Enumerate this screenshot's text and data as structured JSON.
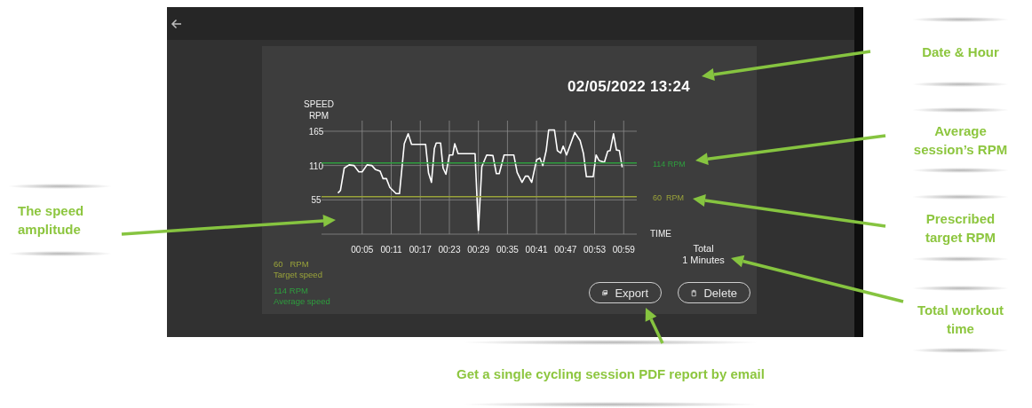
{
  "session": {
    "datetime": "02/05/2022 13:24",
    "total_label": "Total",
    "total_value": "1 Minutes"
  },
  "chart_data": {
    "type": "line",
    "ylabel": "SPEED RPM",
    "xlabel": "TIME",
    "xlim": [
      -3.4,
      61.7
    ],
    "ylim": [
      0,
      182
    ],
    "grid": true,
    "yticks": [
      55,
      110,
      165
    ],
    "xticks": [
      {
        "value": 5,
        "label": "00:05"
      },
      {
        "value": 11,
        "label": "00:11"
      },
      {
        "value": 17,
        "label": "00:17"
      },
      {
        "value": 23,
        "label": "00:23"
      },
      {
        "value": 29,
        "label": "00:29"
      },
      {
        "value": 35,
        "label": "00:35"
      },
      {
        "value": 41,
        "label": "00:41"
      },
      {
        "value": 47,
        "label": "00:47"
      },
      {
        "value": 53,
        "label": "00:53"
      },
      {
        "value": 59,
        "label": "00:59"
      }
    ],
    "x": [
      -3.4,
      0,
      0.5,
      1.3,
      2.3,
      3.3,
      4.3,
      5,
      6,
      7,
      7.7,
      8.7,
      9.3,
      10,
      10.7,
      12,
      12.7,
      13.7,
      14.5,
      15.2,
      18.1,
      18.7,
      19.3,
      19.9,
      20.3,
      21.2,
      21.7,
      22.3,
      23,
      23.7,
      24.1,
      24.8,
      28.3,
      29,
      29.7,
      30.7,
      32,
      32.7,
      33.3,
      34.3,
      36.3,
      37,
      38,
      38.7,
      39.3,
      40,
      41,
      41.7,
      42.3,
      43,
      43.5,
      44.7,
      45.3,
      46,
      46.5,
      47.2,
      48.9,
      50,
      50.7,
      51.3,
      52.7,
      53.3,
      53.9,
      55,
      55.7,
      56.2,
      56.9,
      57.5,
      58.1,
      58.7,
      61.7
    ],
    "series": [
      {
        "color": "#ffffff",
        "values": [
          null,
          66,
          70,
          106,
          111,
          110,
          100,
          100,
          111,
          110,
          104,
          101,
          89,
          89,
          75,
          65,
          65,
          145,
          161,
          144,
          144,
          98,
          83,
          137,
          146,
          146,
          106,
          96,
          127,
          127,
          145,
          129,
          129,
          6,
          108,
          127,
          126,
          97,
          97,
          127,
          127,
          99,
          83,
          93,
          93,
          83,
          119,
          122,
          110,
          134,
          167,
          167,
          134,
          130,
          141,
          127,
          163,
          150,
          129,
          92,
          92,
          127,
          118,
          115,
          133,
          134,
          161,
          135,
          134,
          107,
          null
        ]
      },
      {
        "name": "114 RPM",
        "color": "#2e9e3e",
        "values": [
          114,
          114,
          114,
          114,
          114,
          114,
          114,
          114,
          114,
          114,
          114,
          114,
          114,
          114,
          114,
          114,
          114,
          114,
          114,
          114,
          114,
          114,
          114,
          114,
          114,
          114,
          114,
          114,
          114,
          114,
          114,
          114,
          114,
          114,
          114,
          114,
          114,
          114,
          114,
          114,
          114,
          114,
          114,
          114,
          114,
          114,
          114,
          114,
          114,
          114,
          114,
          114,
          114,
          114,
          114,
          114,
          114,
          114,
          114,
          114,
          114,
          114,
          114,
          114,
          114,
          114,
          114,
          114,
          114,
          114,
          114
        ]
      },
      {
        "name": "60  RPM",
        "color": "#9aa33a",
        "values": [
          60,
          60,
          60,
          60,
          60,
          60,
          60,
          60,
          60,
          60,
          60,
          60,
          60,
          60,
          60,
          60,
          60,
          60,
          60,
          60,
          60,
          60,
          60,
          60,
          60,
          60,
          60,
          60,
          60,
          60,
          60,
          60,
          60,
          60,
          60,
          60,
          60,
          60,
          60,
          60,
          60,
          60,
          60,
          60,
          60,
          60,
          60,
          60,
          60,
          60,
          60,
          60,
          60,
          60,
          60,
          60,
          60,
          60,
          60,
          60,
          60,
          60,
          60,
          60,
          60,
          60,
          60,
          60,
          60,
          60,
          60
        ]
      }
    ]
  },
  "legend": [
    {
      "value": "60   RPM",
      "label": "Target speed",
      "color": "#9aa33a"
    },
    {
      "value": "114 RPM",
      "label": "Average speed",
      "color": "#2e9e3e"
    }
  ],
  "buttons": [
    {
      "kind": "export",
      "label": "Export"
    },
    {
      "kind": "delete",
      "label": "Delete"
    }
  ],
  "callouts": [
    {
      "text": "Date & Hour"
    },
    {
      "text": "Average session’s RPM"
    },
    {
      "text": "Prescribed target RPM"
    },
    {
      "text": "Total workout time"
    },
    {
      "text": "The speed amplitude"
    },
    {
      "text": "Get a single cycling session PDF report by email"
    }
  ]
}
